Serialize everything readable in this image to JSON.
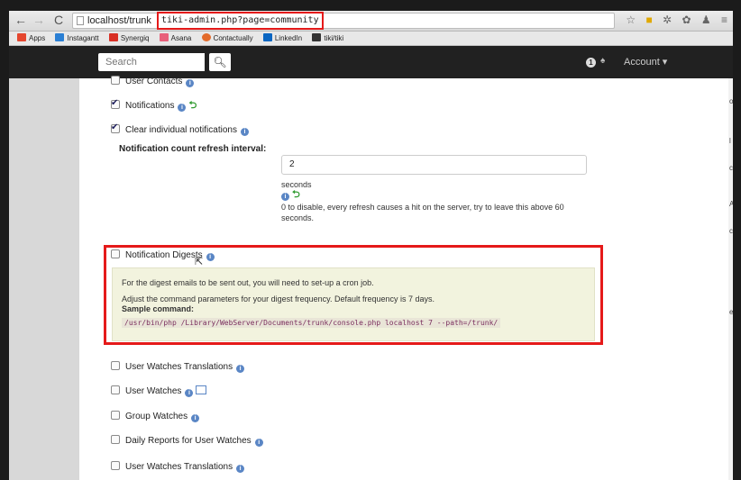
{
  "browser": {
    "url_host": "localhost/trunk",
    "url_path": "tiki-admin.php?page=community",
    "back_icon": "arrow-left-icon",
    "forward_icon": "arrow-right-icon",
    "reload_icon": "reload-icon",
    "bookmarks": [
      {
        "label": "Apps",
        "color": "#e5472f"
      },
      {
        "label": "Instagantt",
        "color": "#2a7fd4"
      },
      {
        "label": "Synergiq",
        "color": "#d93025"
      },
      {
        "label": "Asana",
        "color": "#e8607a"
      },
      {
        "label": "Contactually",
        "color": "#e36b2b"
      },
      {
        "label": "LinkedIn",
        "color": "#0a66c2"
      },
      {
        "label": "tiki/tiki",
        "color": "#333333"
      }
    ]
  },
  "nav": {
    "search_placeholder": "Search",
    "notification_count": "1",
    "account_label": "Account ▾"
  },
  "settings": {
    "user_contacts": "User Contacts",
    "notifications": "Notifications",
    "clear_notifications": "Clear individual notifications",
    "refresh_label": "Notification count refresh interval:",
    "refresh_value": "2",
    "refresh_unit": "seconds",
    "refresh_help": "0 to disable, every refresh causes a hit on the server, try to leave this above 60 seconds.",
    "digests": "Notification Digests",
    "digest_line1": "For the digest emails to be sent out, you will need to set-up a cron job.",
    "digest_line2": "Adjust the command parameters for your digest frequency. Default frequency is 7 days.",
    "digest_sample_label": "Sample command:",
    "digest_command": "/usr/bin/php /Library/WebServer/Documents/trunk/console.php localhost 7 --path=/trunk/",
    "watch_translations": "User Watches Translations",
    "user_watches": "User Watches",
    "group_watches": "Group Watches",
    "daily_reports": "Daily Reports for User Watches",
    "watch_translations_2": "User Watches Translations"
  },
  "colors": {
    "highlight": "#e51a1a",
    "digest_bg": "#f2f3de"
  }
}
